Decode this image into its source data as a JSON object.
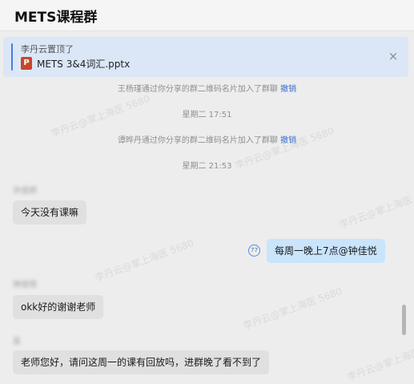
{
  "header": {
    "title": "METS课程群"
  },
  "pinned": {
    "who": "李丹云置顶了",
    "file_icon": "P",
    "file_name": "METS 3&4词汇.pptx",
    "close": "×"
  },
  "system": [
    {
      "text": "王杨瑾通过你分享的群二维码名片加入了群聊",
      "action": "撤销"
    },
    {
      "time": "星期二 17:51"
    },
    {
      "text": "谭晔丹通过你分享的群二维码名片加入了群聊",
      "action": "撤销"
    },
    {
      "time": "星期二 21:53"
    }
  ],
  "messages": [
    {
      "sender": "许佳妍",
      "text": "今天没有课嘛"
    },
    {
      "read": "77",
      "text": "每周一晚上7点@钟佳悦"
    },
    {
      "sender": "钟佳悦",
      "text": "okk好的谢谢老师"
    },
    {
      "sender": "吴",
      "text": "老师您好，请问这周一的课有回放吗，进群晚了看不到了"
    }
  ],
  "watermark": "李丹云@掌上海医 5680"
}
